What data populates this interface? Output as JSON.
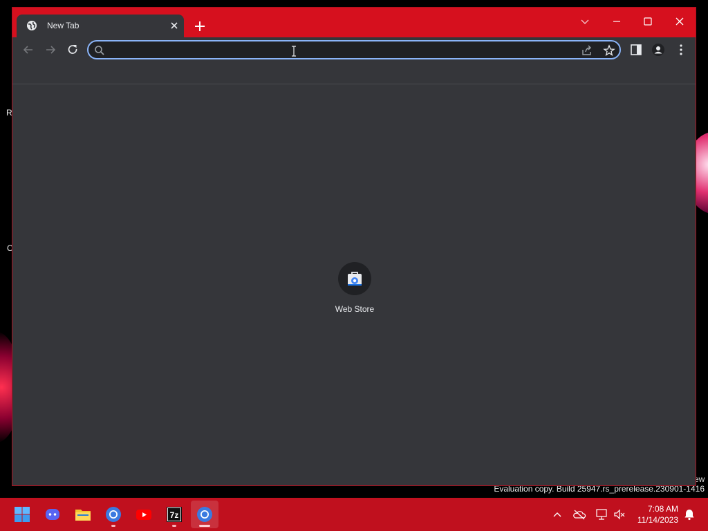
{
  "browser": {
    "tab": {
      "title": "New Tab"
    },
    "omnibox": {
      "value": ""
    },
    "new_tab_page": {
      "shortcuts": [
        {
          "label": "Web Store"
        }
      ]
    }
  },
  "desktop": {
    "fragments": [
      "R",
      "C"
    ],
    "watermark": "Evaluation copy. Build 25947.rs_prerelease.230901-1416",
    "watermark_fragment": "ew"
  },
  "taskbar": {
    "apps": [
      "start-icon",
      "discord-icon",
      "file-explorer-icon",
      "chrome-icon",
      "youtube-icon",
      "7zip-icon",
      "chrome-icon"
    ],
    "app_7zip_label": "7z",
    "clock": {
      "time": "7:08 AM",
      "date": "11/14/2023"
    }
  },
  "colors": {
    "accent_red": "#d6101e",
    "taskbar_red": "#c0101e",
    "browser_bg": "#35363a",
    "omnibox_focus": "#8ab4f8"
  }
}
